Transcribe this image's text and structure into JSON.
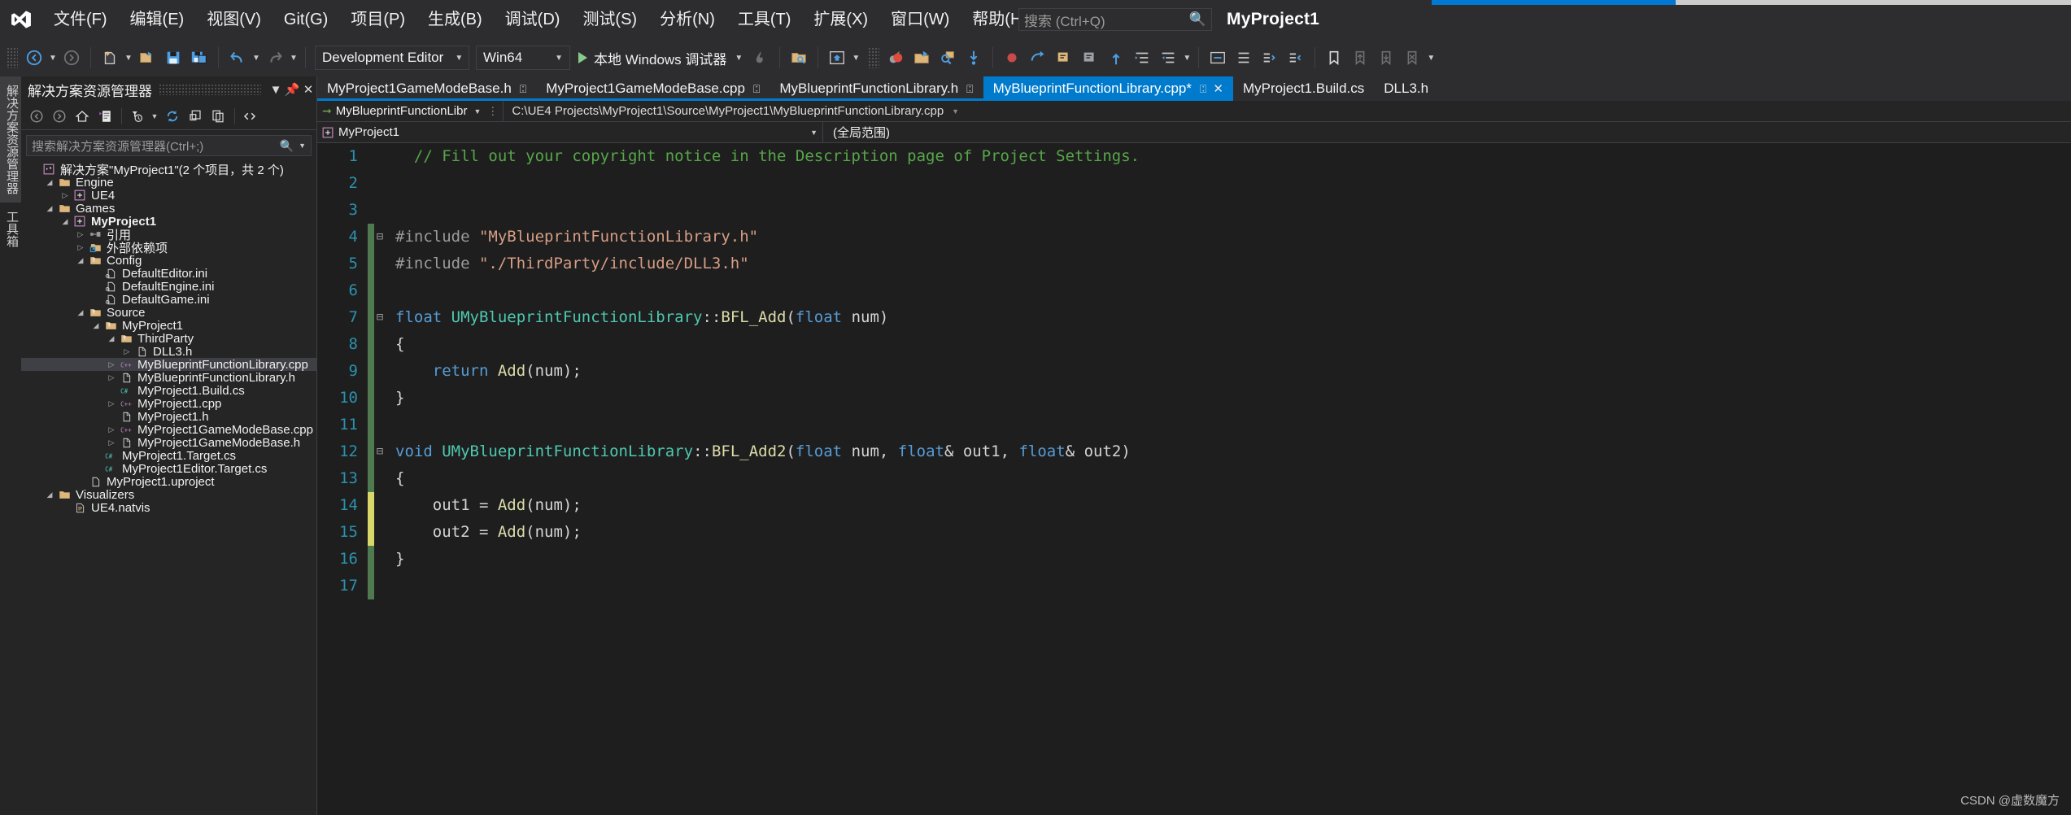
{
  "window": {
    "project_title": "MyProject1",
    "accent_color": "#0078d4"
  },
  "menu": {
    "items": [
      {
        "label": "文件(F)",
        "name": "menu-file"
      },
      {
        "label": "编辑(E)",
        "name": "menu-edit"
      },
      {
        "label": "视图(V)",
        "name": "menu-view"
      },
      {
        "label": "Git(G)",
        "name": "menu-git"
      },
      {
        "label": "项目(P)",
        "name": "menu-project"
      },
      {
        "label": "生成(B)",
        "name": "menu-build"
      },
      {
        "label": "调试(D)",
        "name": "menu-debug"
      },
      {
        "label": "测试(S)",
        "name": "menu-test"
      },
      {
        "label": "分析(N)",
        "name": "menu-analyze"
      },
      {
        "label": "工具(T)",
        "name": "menu-tools"
      },
      {
        "label": "扩展(X)",
        "name": "menu-extensions"
      },
      {
        "label": "窗口(W)",
        "name": "menu-window"
      },
      {
        "label": "帮助(H)",
        "name": "menu-help"
      }
    ],
    "search_placeholder": "搜索 (Ctrl+Q)",
    "search_icon": "magnifier-icon"
  },
  "toolbar": {
    "configuration": "Development Editor",
    "platform": "Win64",
    "run_label": "本地 Windows 调试器",
    "icons": [
      "navigate-back-icon",
      "navigate-forward-icon",
      "new-file-icon",
      "open-file-icon",
      "save-icon",
      "save-all-icon",
      "undo-icon",
      "redo-icon",
      "start-debug-icon",
      "hot-reload-icon",
      "find-in-files-icon",
      "home-window-icon",
      "resharper-icon",
      "attach-icon",
      "search-code-icon",
      "step-into-icon",
      "step-over-icon",
      "step-out-icon",
      "breakpoint-icon",
      "comment-icon",
      "uncomment-icon",
      "indent-icon",
      "outdent-icon",
      "bookmark-icon",
      "prev-bookmark-icon",
      "next-bookmark-icon",
      "clear-bookmark-icon"
    ]
  },
  "left_tabs": [
    {
      "label": "解决方案资源管理器",
      "name": "vtab-solution-explorer",
      "selected": true
    },
    {
      "label": "工具箱",
      "name": "vtab-toolbox",
      "selected": false
    }
  ],
  "solution_explorer": {
    "title": "解决方案资源管理器",
    "dropdown_icon": "chevron-down-icon",
    "pin_icon": "pin-icon",
    "close_icon": "close-icon",
    "toolbar_icons": [
      "back-icon",
      "forward-icon",
      "home-icon",
      "solution-view-icon",
      "pending-changes-filter-icon",
      "filter-dropdown-icon",
      "refresh-icon",
      "collapse-all-icon",
      "show-all-files-icon",
      "code-view-icon",
      "properties-icon",
      "more-icon"
    ],
    "search_placeholder": "搜索解决方案资源管理器(Ctrl+;)",
    "search_icon": "magnifier-icon",
    "tree": [
      {
        "indent": 0,
        "arrow": "",
        "icon": "solution-icon",
        "label": "解决方案\"MyProject1\"(2 个项目，共 2 个)",
        "bold": false,
        "selected": false
      },
      {
        "indent": 1,
        "arrow": "v",
        "icon": "folder-icon",
        "label": "Engine",
        "bold": false,
        "selected": false
      },
      {
        "indent": 2,
        "arrow": ">",
        "icon": "project-icon",
        "label": "UE4",
        "bold": false,
        "selected": false
      },
      {
        "indent": 1,
        "arrow": "v",
        "icon": "folder-icon",
        "label": "Games",
        "bold": false,
        "selected": false
      },
      {
        "indent": 2,
        "arrow": "v",
        "icon": "project-icon",
        "label": "MyProject1",
        "bold": true,
        "selected": false
      },
      {
        "indent": 3,
        "arrow": ">",
        "icon": "references-icon",
        "label": "引用",
        "bold": false,
        "selected": false
      },
      {
        "indent": 3,
        "arrow": ">",
        "icon": "ext-dep-icon",
        "label": "外部依赖项",
        "bold": false,
        "selected": false
      },
      {
        "indent": 3,
        "arrow": "v",
        "icon": "filter-folder-icon",
        "label": "Config",
        "bold": false,
        "selected": false
      },
      {
        "indent": 4,
        "arrow": "",
        "icon": "ini-file-icon",
        "label": "DefaultEditor.ini",
        "bold": false,
        "selected": false
      },
      {
        "indent": 4,
        "arrow": "",
        "icon": "ini-file-icon",
        "label": "DefaultEngine.ini",
        "bold": false,
        "selected": false
      },
      {
        "indent": 4,
        "arrow": "",
        "icon": "ini-file-icon",
        "label": "DefaultGame.ini",
        "bold": false,
        "selected": false
      },
      {
        "indent": 3,
        "arrow": "v",
        "icon": "filter-folder-icon",
        "label": "Source",
        "bold": false,
        "selected": false
      },
      {
        "indent": 4,
        "arrow": "v",
        "icon": "filter-folder-icon",
        "label": "MyProject1",
        "bold": false,
        "selected": false
      },
      {
        "indent": 5,
        "arrow": "v",
        "icon": "filter-folder-icon",
        "label": "ThirdParty",
        "bold": false,
        "selected": false
      },
      {
        "indent": 6,
        "arrow": ">",
        "icon": "h-file-icon",
        "label": "DLL3.h",
        "bold": false,
        "selected": false
      },
      {
        "indent": 5,
        "arrow": ">",
        "icon": "cpp-file-icon",
        "label": "MyBlueprintFunctionLibrary.cpp",
        "bold": false,
        "selected": true
      },
      {
        "indent": 5,
        "arrow": ">",
        "icon": "h-file-icon",
        "label": "MyBlueprintFunctionLibrary.h",
        "bold": false,
        "selected": false
      },
      {
        "indent": 5,
        "arrow": "",
        "icon": "cs-file-icon",
        "label": "MyProject1.Build.cs",
        "bold": false,
        "selected": false
      },
      {
        "indent": 5,
        "arrow": ">",
        "icon": "cpp-file-icon",
        "label": "MyProject1.cpp",
        "bold": false,
        "selected": false
      },
      {
        "indent": 5,
        "arrow": "",
        "icon": "h-file-icon",
        "label": "MyProject1.h",
        "bold": false,
        "selected": false
      },
      {
        "indent": 5,
        "arrow": ">",
        "icon": "cpp-file-icon",
        "label": "MyProject1GameModeBase.cpp",
        "bold": false,
        "selected": false
      },
      {
        "indent": 5,
        "arrow": ">",
        "icon": "h-file-icon",
        "label": "MyProject1GameModeBase.h",
        "bold": false,
        "selected": false
      },
      {
        "indent": 4,
        "arrow": "",
        "icon": "cs-file-icon",
        "label": "MyProject1.Target.cs",
        "bold": false,
        "selected": false
      },
      {
        "indent": 4,
        "arrow": "",
        "icon": "cs-file-icon",
        "label": "MyProject1Editor.Target.cs",
        "bold": false,
        "selected": false
      },
      {
        "indent": 3,
        "arrow": "",
        "icon": "generic-file-icon",
        "label": "MyProject1.uproject",
        "bold": false,
        "selected": false
      },
      {
        "indent": 1,
        "arrow": "v",
        "icon": "folder-icon",
        "label": "Visualizers",
        "bold": false,
        "selected": false
      },
      {
        "indent": 2,
        "arrow": "",
        "icon": "natvis-file-icon",
        "label": "UE4.natvis",
        "bold": false,
        "selected": false
      }
    ]
  },
  "editor": {
    "tabs": [
      {
        "label": "MyProject1GameModeBase.h",
        "name": "tab-gamemodebase-h",
        "active": false,
        "pinned": true,
        "closable": false,
        "underline": true
      },
      {
        "label": "MyProject1GameModeBase.cpp",
        "name": "tab-gamemodebase-cpp",
        "active": false,
        "pinned": true,
        "closable": false,
        "underline": true
      },
      {
        "label": "MyBlueprintFunctionLibrary.h",
        "name": "tab-bpfl-h",
        "active": false,
        "pinned": true,
        "closable": false,
        "underline": true
      },
      {
        "label": "MyBlueprintFunctionLibrary.cpp*",
        "name": "tab-bpfl-cpp",
        "active": true,
        "pinned": true,
        "closable": true,
        "underline": true
      },
      {
        "label": "MyProject1.Build.cs",
        "name": "tab-build-cs",
        "active": false,
        "pinned": false,
        "closable": false,
        "underline": false
      },
      {
        "label": "DLL3.h",
        "name": "tab-dll3-h",
        "active": false,
        "pinned": false,
        "closable": false,
        "underline": false
      }
    ],
    "nav_project": "MyBlueprintFunctionLibr",
    "nav_path": "C:\\UE4 Projects\\MyProject1\\Source\\MyProject1\\MyBlueprintFunctionLibrary.cpp",
    "scope_left": "MyProject1",
    "scope_right": "(全局范围)",
    "lines": [
      {
        "n": 1,
        "gutter": "none",
        "fold": "",
        "tokens": [
          {
            "t": "  // Fill out your copyright notice in the Description page of Project Settings.",
            "c": "c-comment"
          }
        ]
      },
      {
        "n": 2,
        "gutter": "none",
        "fold": "",
        "tokens": []
      },
      {
        "n": 3,
        "gutter": "none",
        "fold": "",
        "tokens": []
      },
      {
        "n": 4,
        "gutter": "green",
        "fold": "-",
        "tokens": [
          {
            "t": "#include ",
            "c": "c-pre"
          },
          {
            "t": "\"MyBlueprintFunctionLibrary.h\"",
            "c": "c-str"
          }
        ]
      },
      {
        "n": 5,
        "gutter": "green",
        "fold": "",
        "tokens": [
          {
            "t": "#include ",
            "c": "c-pre"
          },
          {
            "t": "\"./ThirdParty/include/DLL3.h\"",
            "c": "c-str"
          }
        ]
      },
      {
        "n": 6,
        "gutter": "green",
        "fold": "",
        "tokens": []
      },
      {
        "n": 7,
        "gutter": "green",
        "fold": "-",
        "tokens": [
          {
            "t": "float ",
            "c": "c-kw"
          },
          {
            "t": "UMyBlueprintFunctionLibrary",
            "c": "c-type"
          },
          {
            "t": "::",
            "c": "c-punct"
          },
          {
            "t": "BFL_Add",
            "c": "c-fn"
          },
          {
            "t": "(",
            "c": "c-punct"
          },
          {
            "t": "float",
            "c": "c-kw"
          },
          {
            "t": " num)",
            "c": "c-plain"
          }
        ]
      },
      {
        "n": 8,
        "gutter": "green",
        "fold": "",
        "tokens": [
          {
            "t": "{",
            "c": "c-punct"
          }
        ]
      },
      {
        "n": 9,
        "gutter": "green",
        "fold": "",
        "tokens": [
          {
            "t": "    return ",
            "c": "c-kw"
          },
          {
            "t": "Add",
            "c": "c-fn"
          },
          {
            "t": "(num);",
            "c": "c-plain"
          }
        ]
      },
      {
        "n": 10,
        "gutter": "green",
        "fold": "",
        "tokens": [
          {
            "t": "}",
            "c": "c-punct"
          }
        ]
      },
      {
        "n": 11,
        "gutter": "green",
        "fold": "",
        "tokens": []
      },
      {
        "n": 12,
        "gutter": "green",
        "fold": "-",
        "tokens": [
          {
            "t": "void ",
            "c": "c-kw"
          },
          {
            "t": "UMyBlueprintFunctionLibrary",
            "c": "c-type"
          },
          {
            "t": "::",
            "c": "c-punct"
          },
          {
            "t": "BFL_Add2",
            "c": "c-fn"
          },
          {
            "t": "(",
            "c": "c-punct"
          },
          {
            "t": "float",
            "c": "c-kw"
          },
          {
            "t": " num, ",
            "c": "c-plain"
          },
          {
            "t": "float",
            "c": "c-kw"
          },
          {
            "t": "& out1, ",
            "c": "c-plain"
          },
          {
            "t": "float",
            "c": "c-kw"
          },
          {
            "t": "& out2)",
            "c": "c-plain"
          }
        ]
      },
      {
        "n": 13,
        "gutter": "green",
        "fold": "",
        "tokens": [
          {
            "t": "{",
            "c": "c-punct"
          }
        ]
      },
      {
        "n": 14,
        "gutter": "yellow",
        "fold": "",
        "tokens": [
          {
            "t": "    out1 = ",
            "c": "c-plain"
          },
          {
            "t": "Add",
            "c": "c-fn"
          },
          {
            "t": "(num);",
            "c": "c-plain"
          }
        ]
      },
      {
        "n": 15,
        "gutter": "yellow",
        "fold": "",
        "tokens": [
          {
            "t": "    out2 = ",
            "c": "c-plain"
          },
          {
            "t": "Add",
            "c": "c-fn"
          },
          {
            "t": "(num);",
            "c": "c-plain"
          }
        ]
      },
      {
        "n": 16,
        "gutter": "green",
        "fold": "",
        "tokens": [
          {
            "t": "}",
            "c": "c-punct"
          }
        ]
      },
      {
        "n": 17,
        "gutter": "green",
        "fold": "",
        "tokens": []
      }
    ]
  },
  "watermark": "CSDN @虚数魔方"
}
